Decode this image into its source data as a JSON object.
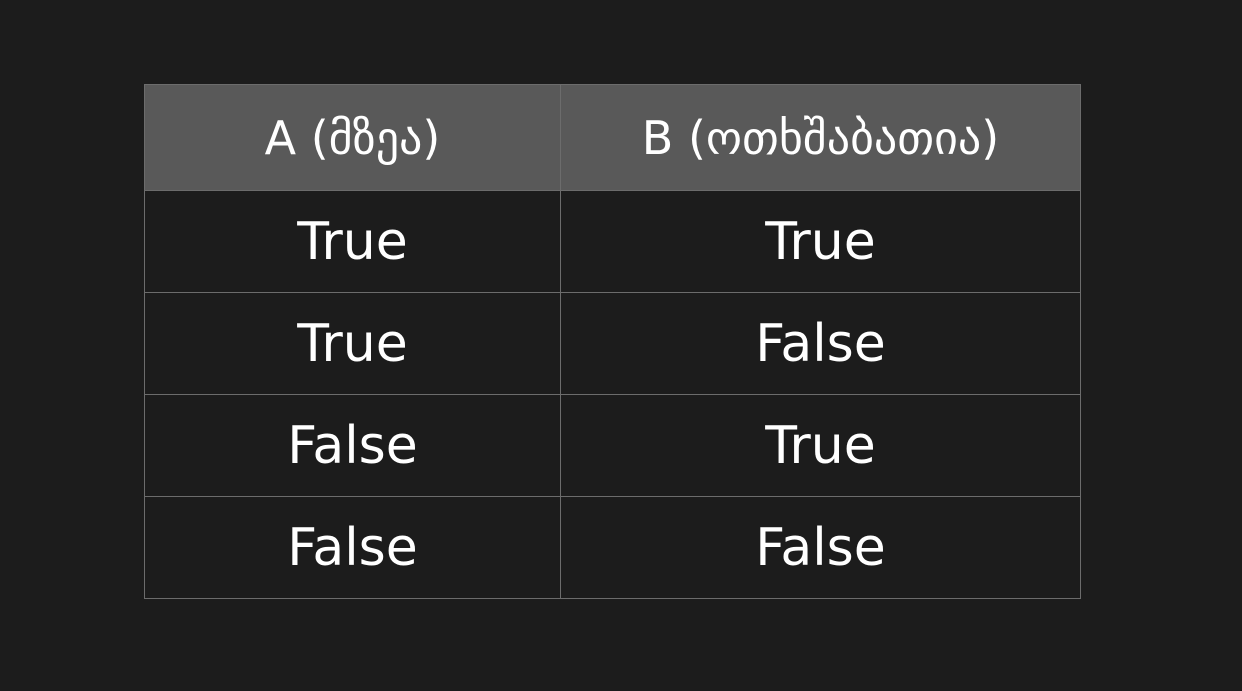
{
  "table": {
    "headers": [
      "A (მზეა)",
      "B (ოთხშაბათია)"
    ],
    "rows": [
      [
        "True",
        "True"
      ],
      [
        "True",
        "False"
      ],
      [
        "False",
        "True"
      ],
      [
        "False",
        "False"
      ]
    ]
  },
  "colors": {
    "background": "#1c1c1c",
    "header_background": "#595959",
    "border": "#6c6c6c",
    "text": "#ffffff"
  }
}
